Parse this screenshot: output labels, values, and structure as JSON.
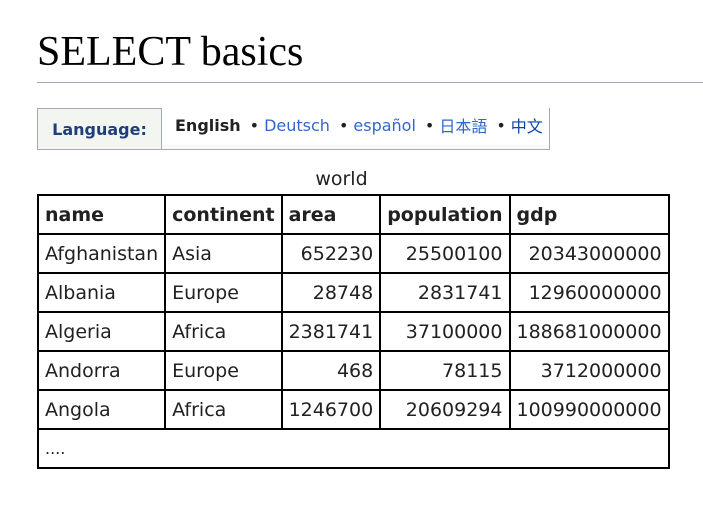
{
  "page": {
    "title": "SELECT basics"
  },
  "language_bar": {
    "label": "Language:",
    "current": "English",
    "links": [
      "Deutsch",
      "español",
      "日本語",
      "中文"
    ],
    "separator": "•"
  },
  "table": {
    "caption": "world",
    "columns": [
      "name",
      "continent",
      "area",
      "population",
      "gdp"
    ],
    "rows": [
      [
        "Afghanistan",
        "Asia",
        "652230",
        "25500100",
        "20343000000"
      ],
      [
        "Albania",
        "Europe",
        "28748",
        "2831741",
        "12960000000"
      ],
      [
        "Algeria",
        "Africa",
        "2381741",
        "37100000",
        "188681000000"
      ],
      [
        "Andorra",
        "Europe",
        "468",
        "78115",
        "3712000000"
      ],
      [
        "Angola",
        "Africa",
        "1246700",
        "20609294",
        "100990000000"
      ]
    ],
    "more": "...."
  }
}
